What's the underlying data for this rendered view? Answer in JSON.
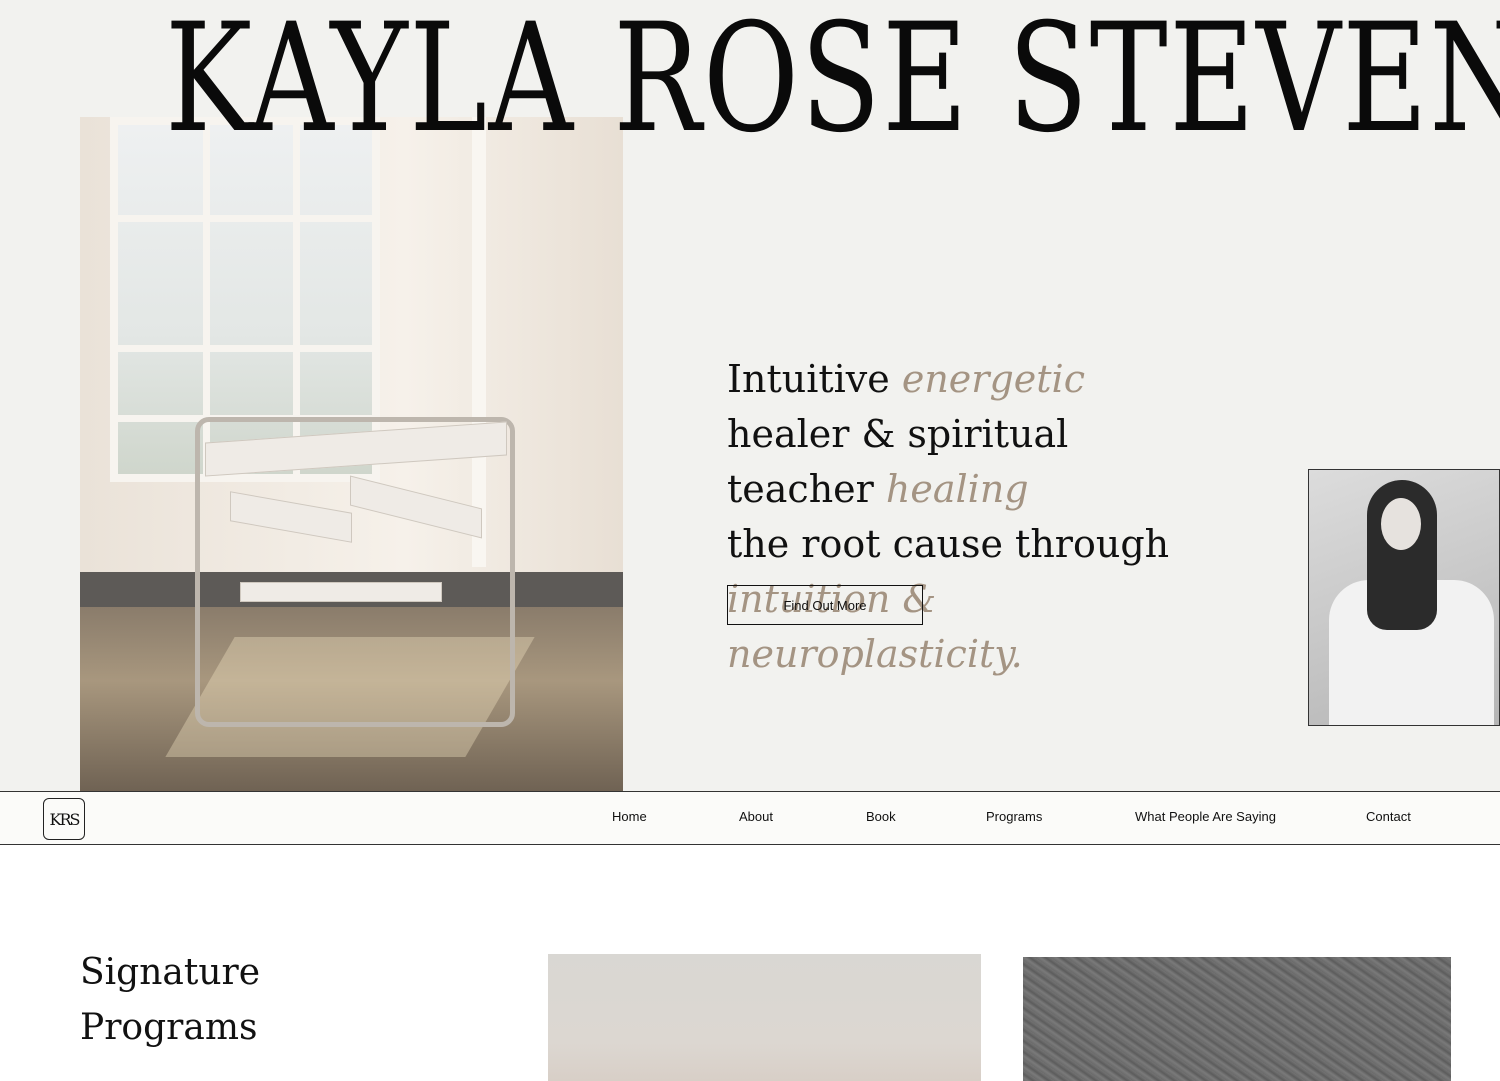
{
  "hero": {
    "site_title": "KAYLA ROSE STEVENS",
    "tagline": {
      "part1": "Intuitive ",
      "part2_em": "energetic",
      "part3": " healer & spiritual teacher ",
      "part4_em": "healing",
      "part5": " the root cause through ",
      "part6_em": "intuition & neuroplasticity."
    },
    "cta_label": "Find Out More",
    "accent_color": "#a49483"
  },
  "nav": {
    "logo_text": "KRS",
    "items": [
      {
        "label": "Home"
      },
      {
        "label": "About"
      },
      {
        "label": "Book"
      },
      {
        "label": "Programs"
      },
      {
        "label": "What People Are Saying"
      },
      {
        "label": "Contact"
      }
    ]
  },
  "programs": {
    "title_line1": "Signature",
    "title_line2": "Programs"
  }
}
